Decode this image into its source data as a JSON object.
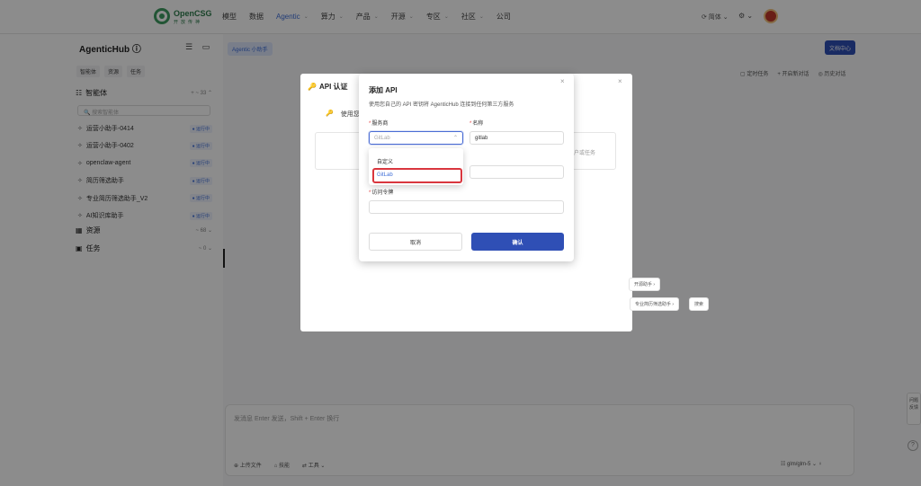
{
  "topnav": {
    "logo_text": "OpenCSG",
    "logo_sub": "开放传神",
    "items": [
      {
        "label": "模型",
        "caret": false,
        "active": false
      },
      {
        "label": "数据",
        "caret": false,
        "active": false
      },
      {
        "label": "Agentic",
        "caret": true,
        "active": true
      },
      {
        "label": "算力",
        "caret": true,
        "active": false
      },
      {
        "label": "产品",
        "caret": true,
        "active": false
      },
      {
        "label": "开源",
        "caret": true,
        "active": false
      },
      {
        "label": "专区",
        "caret": true,
        "active": false
      },
      {
        "label": "社区",
        "caret": true,
        "active": false
      },
      {
        "label": "公司",
        "caret": false,
        "active": false
      }
    ],
    "lang": "⟳ 简体 ⌄",
    "settings": "⚙ ⌄"
  },
  "sidebar": {
    "title": "AgenticHub ⓘ",
    "title_icons": "☰ ▭",
    "tabs": [
      "智能体",
      "资源",
      "任务"
    ],
    "agents_section": {
      "icon": "☷",
      "label": "智能体",
      "count": "+  ~ 33  ⌃"
    },
    "search_placeholder": "🔍 搜索智能体",
    "agents": [
      {
        "name": "运营小助手-0414",
        "badge": "● 运行中"
      },
      {
        "name": "运营小助手-0402",
        "badge": "● 运行中"
      },
      {
        "name": "openclaw-agent",
        "badge": "● 运行中"
      },
      {
        "name": "简历筛选助手",
        "badge": "● 运行中"
      },
      {
        "name": "专业简历筛选助手_V2",
        "badge": "● 运行中"
      },
      {
        "name": "AI知识库助手",
        "badge": "● 运行中"
      }
    ],
    "resources_section": {
      "icon": "▦",
      "label": "资源",
      "count": "~ 68  ⌄"
    },
    "tasks_section": {
      "icon": "▣",
      "label": "任务",
      "count": "~ 0  ⌄"
    }
  },
  "main": {
    "chip": "Agentic 小助手",
    "primary_button": "文档中心",
    "links": [
      "▢ 定时任务",
      "+ 开启新对话",
      "◎ 历史对话"
    ],
    "input_placeholder": "发消息 Enter 发送，Shift + Enter 换行",
    "tools": [
      "⊕ 上传文件",
      "⌂ 技能",
      "⇄ 工具 ⌄"
    ],
    "model": "☷ glm/glm-5 ⌄   ♀",
    "side_feedback": "问题 反馈",
    "help": "?"
  },
  "auth_panel": {
    "title": "API 认证",
    "icon": "🔑",
    "use_text": "使用您",
    "box_text": "户或任务",
    "chips": [
      "开源助手 ›",
      "专业简历筛选助手 ›",
      "搜索"
    ]
  },
  "dialog": {
    "title": "添加 API",
    "close": "×",
    "description": "使用您自己的 API 密钥将 AgenticHub 连接到任何第三方服务",
    "provider_label": "服务商",
    "provider_placeholder": "GitLab",
    "name_label": "名称",
    "name_value": "gitlab",
    "token_label": "访问令牌",
    "options": [
      "自定义",
      "GitLab"
    ],
    "cancel": "取消",
    "confirm": "确认"
  }
}
